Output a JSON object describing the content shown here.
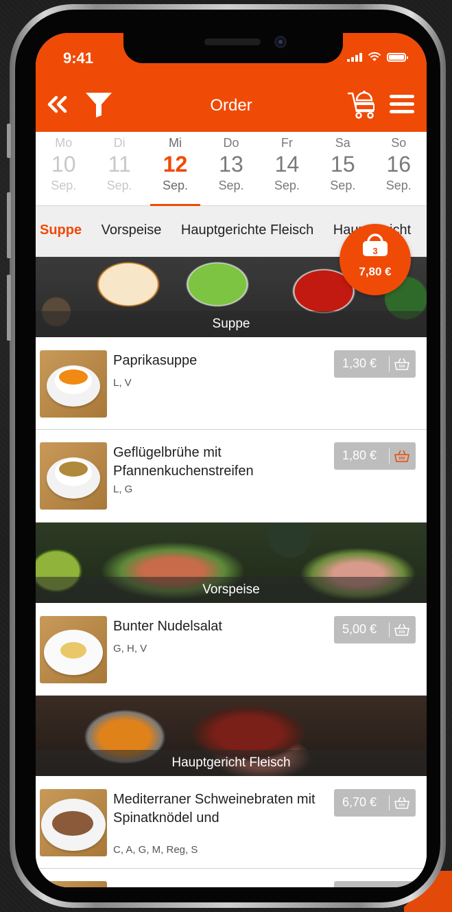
{
  "status": {
    "time": "9:41"
  },
  "nav": {
    "title": "Order"
  },
  "days": [
    {
      "name": "Mo",
      "date": "10",
      "month": "Sep."
    },
    {
      "name": "Di",
      "date": "11",
      "month": "Sep."
    },
    {
      "name": "Mi",
      "date": "12",
      "month": "Sep."
    },
    {
      "name": "Do",
      "date": "13",
      "month": "Sep."
    },
    {
      "name": "Fr",
      "date": "14",
      "month": "Sep."
    },
    {
      "name": "Sa",
      "date": "15",
      "month": "Sep."
    },
    {
      "name": "So",
      "date": "16",
      "month": "Sep."
    }
  ],
  "selected_day": "Mi",
  "categories": [
    "Suppe",
    "Vorspeise",
    "Hauptgerichte Fleisch",
    "Hauptgericht"
  ],
  "active_category": "Suppe",
  "cart": {
    "count": "3",
    "total": "7,80 €"
  },
  "sections": [
    {
      "title": "Suppe",
      "items": [
        {
          "name": "Paprikasuppe",
          "allergens": "L, V",
          "price": "1,30 €"
        },
        {
          "name": "Geflügelbrühe mit Pfannenkuchenstreifen",
          "allergens": "L, G",
          "price": "1,80 €",
          "in_cart": true
        }
      ]
    },
    {
      "title": "Vorspeise",
      "items": [
        {
          "name": "Bunter Nudelsalat",
          "allergens": "G, H, V",
          "price": "5,00 €"
        }
      ]
    },
    {
      "title": "Hauptgericht Fleisch",
      "items": [
        {
          "name": "Mediterraner Schweinebraten mit Spinatknödel und",
          "allergens": "C, A, G, M, Reg, S",
          "price": "6,70 €"
        }
      ]
    }
  ],
  "colors": {
    "accent": "#f04a07",
    "price_button": "#bdbdbd",
    "category_bar": "#efefef"
  }
}
